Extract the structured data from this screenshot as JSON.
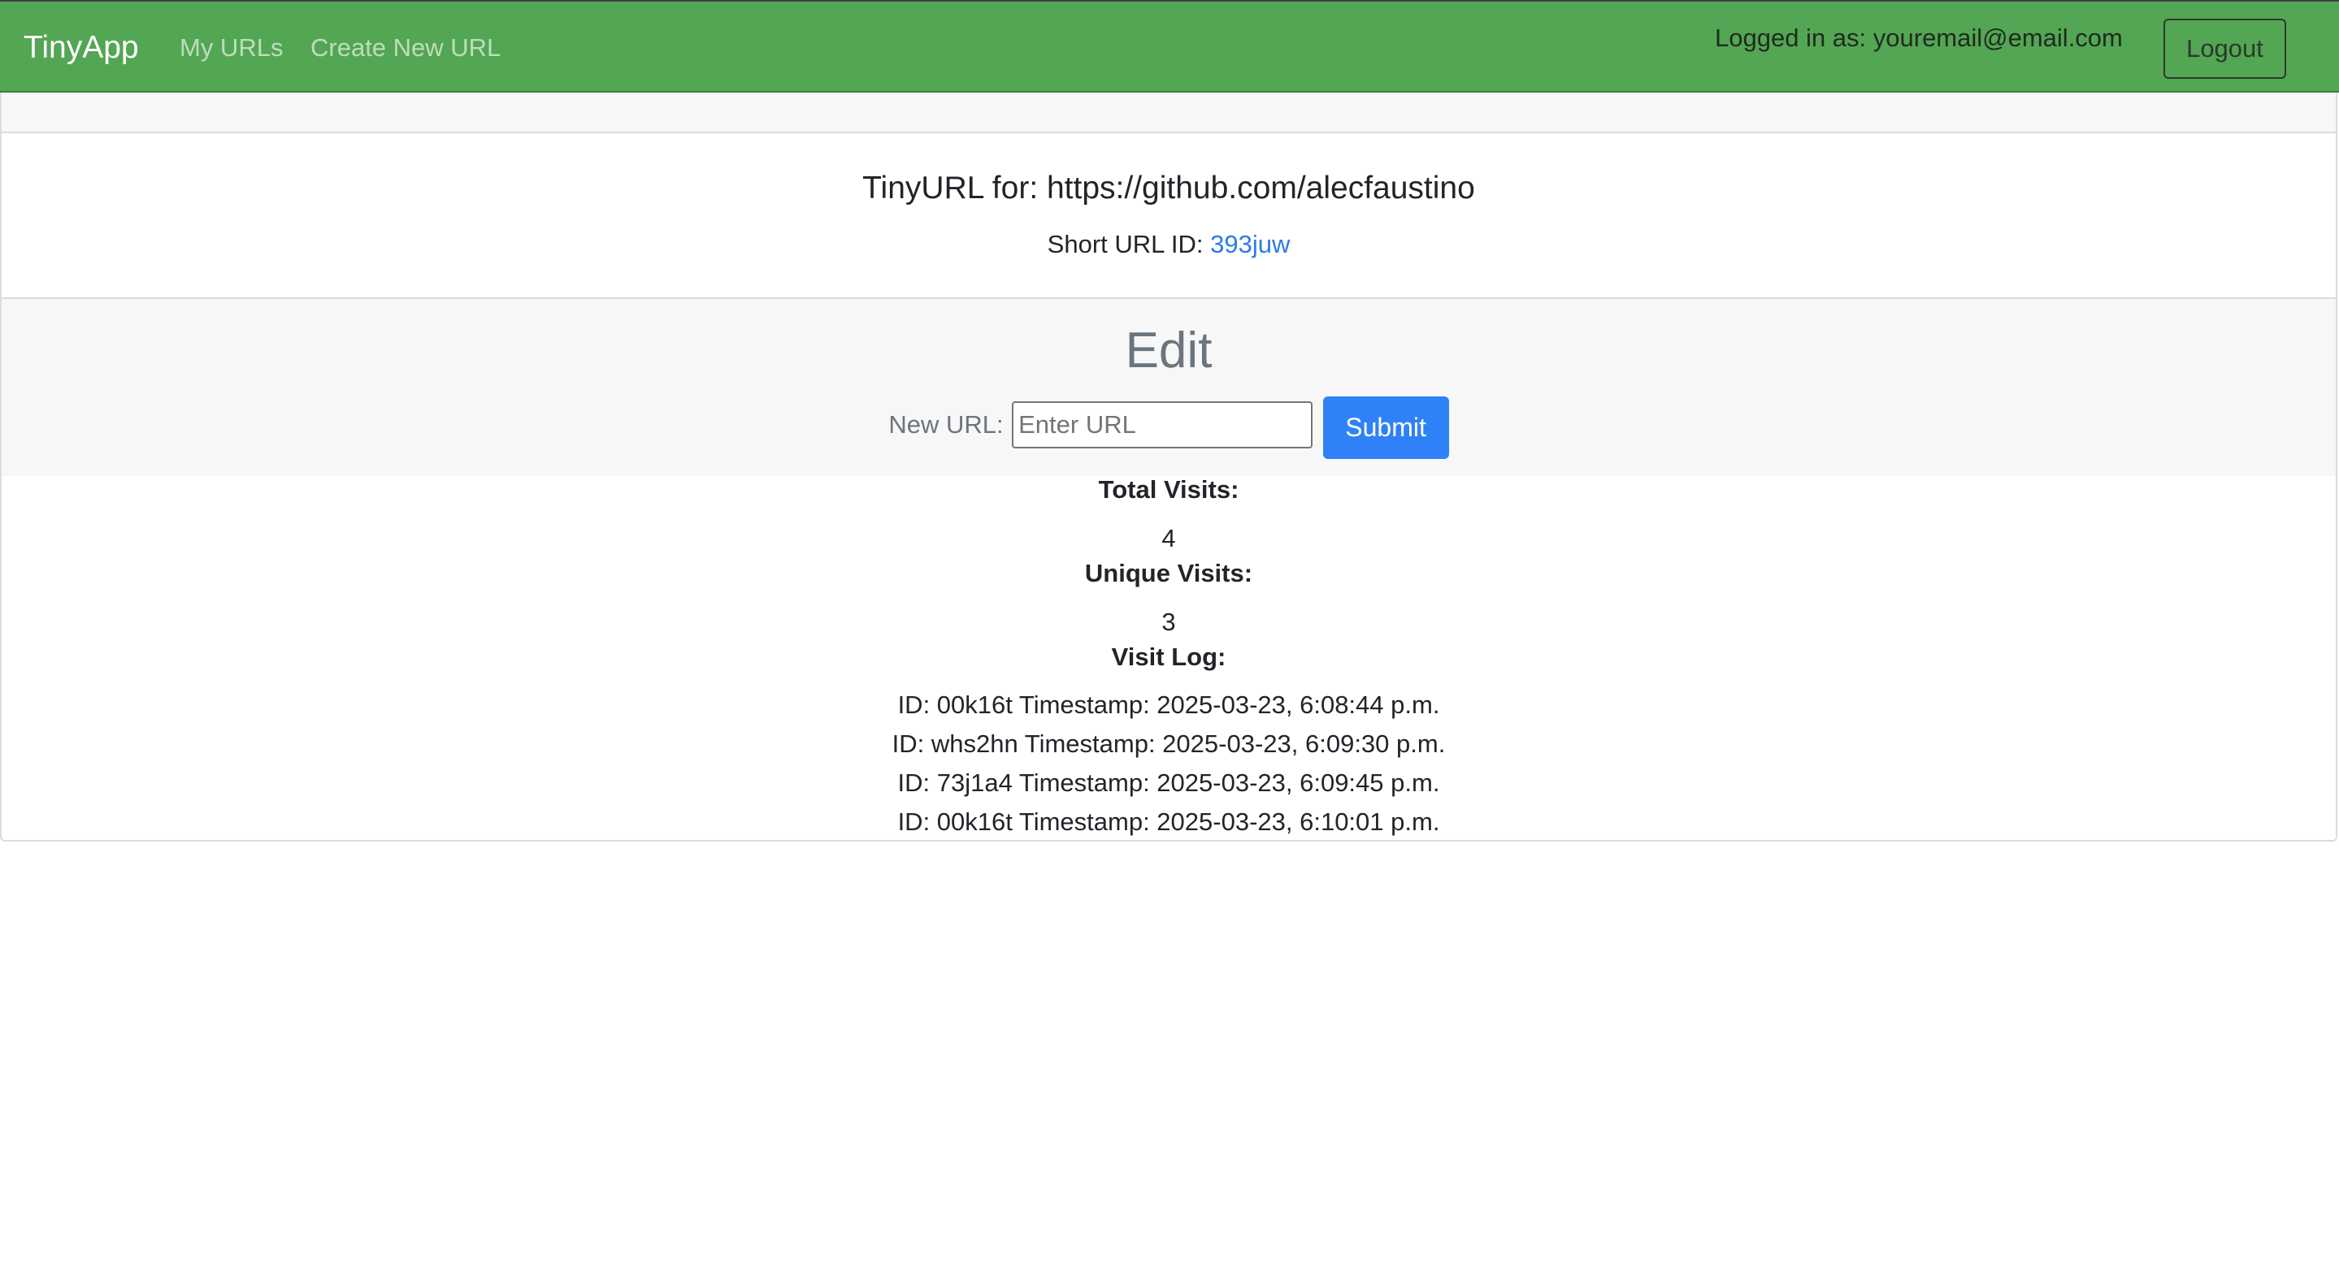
{
  "navbar": {
    "brand": "TinyApp",
    "links": [
      "My URLs",
      "Create New URL"
    ],
    "logged_in_text": "Logged in as: youremail@email.com",
    "logout_label": "Logout",
    "background_color": "#53a653"
  },
  "url_info": {
    "title": "TinyURL for: https://github.com/alecfaustino",
    "short_url_label": "Short URL ID:",
    "short_url_id": "393juw",
    "link_color": "#2d7be5"
  },
  "edit": {
    "heading": "Edit",
    "new_url_label": "New URL:",
    "input_placeholder": "Enter URL",
    "input_value": "",
    "submit_label": "Submit",
    "submit_color": "#2f81f7"
  },
  "stats": {
    "total_visits_label": "Total Visits:",
    "total_visits": "4",
    "unique_visits_label": "Unique Visits:",
    "unique_visits": "3",
    "visit_log_label": "Visit Log:",
    "visit_log": [
      "ID: 00k16t Timestamp: 2025-03-23, 6:08:44 p.m.",
      "ID: whs2hn Timestamp: 2025-03-23, 6:09:30 p.m.",
      "ID: 73j1a4 Timestamp: 2025-03-23, 6:09:45 p.m.",
      "ID: 00k16t Timestamp: 2025-03-23, 6:10:01 p.m."
    ]
  }
}
